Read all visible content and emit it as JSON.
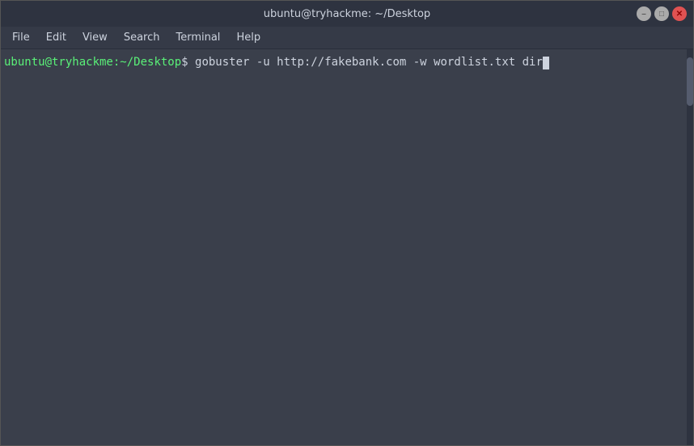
{
  "titlebar": {
    "title": "ubuntu@tryhackme: ~/Desktop",
    "minimize_label": "–",
    "maximize_label": "□",
    "close_label": "✕"
  },
  "menubar": {
    "items": [
      {
        "label": "File"
      },
      {
        "label": "Edit"
      },
      {
        "label": "View"
      },
      {
        "label": "Search"
      },
      {
        "label": "Terminal"
      },
      {
        "label": "Help"
      }
    ]
  },
  "terminal": {
    "prompt_user": "ubuntu@tryhackme:",
    "prompt_path": "~/Desktop",
    "prompt_symbol": "$",
    "command": " gobuster -u http://fakebank.com -w wordlist.txt dir"
  }
}
